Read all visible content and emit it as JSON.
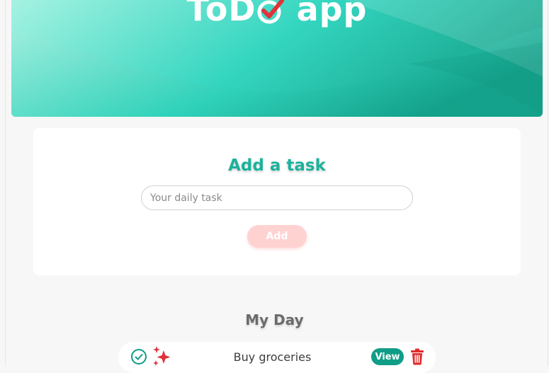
{
  "header": {
    "title_prefix": "ToD",
    "title_suffix": " app",
    "logo_icon": "check-circle-icon"
  },
  "add_task": {
    "title": "Add a task",
    "input_placeholder": "Your daily task",
    "input_value": "",
    "add_label": "Add"
  },
  "my_day": {
    "title": "My Day",
    "tasks": [
      {
        "text": "Buy groceries",
        "view_label": "View",
        "complete_icon": "check-circle-icon",
        "sparkle_icon": "sparkles-icon",
        "delete_icon": "trash-icon"
      }
    ]
  },
  "colors": {
    "teal": "#1cb29c",
    "teal_dark": "#109d87",
    "add_button": "#ffd2d2",
    "delete_red": "#e12b2b"
  }
}
